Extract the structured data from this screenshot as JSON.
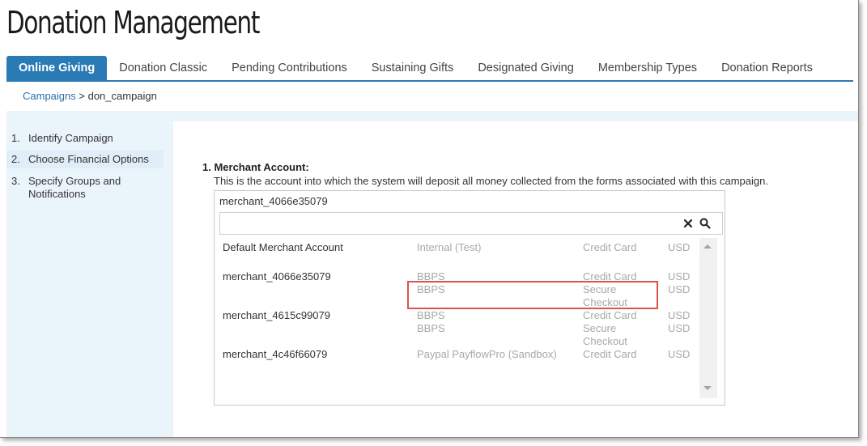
{
  "app": {
    "title": "Donation Management"
  },
  "tabs": [
    {
      "label": "Online Giving",
      "active": true
    },
    {
      "label": "Donation Classic"
    },
    {
      "label": "Pending Contributions"
    },
    {
      "label": "Sustaining Gifts"
    },
    {
      "label": "Designated Giving"
    },
    {
      "label": "Membership Types"
    },
    {
      "label": "Donation Reports"
    }
  ],
  "breadcrumb": {
    "link": "Campaigns",
    "separator": " > ",
    "current": "don_campaign"
  },
  "steps": [
    {
      "num": "1.",
      "label": "Identify Campaign"
    },
    {
      "num": "2.",
      "label": "Choose Financial Options",
      "active": true
    },
    {
      "num": "3.",
      "label": "Specify Groups and Notifications"
    }
  ],
  "merchant": {
    "label": "1. Merchant Account:",
    "description": "This is the account into which the system will deposit all money collected from the forms associated with this campaign.",
    "selected": "merchant_4066e35079",
    "search_value": "",
    "rows": [
      {
        "name": "Default Merchant Account",
        "processor": "Internal (Test)",
        "type": "Credit Card",
        "currency": "USD"
      },
      {
        "name": "merchant_4066e35079",
        "processor": "BBPS",
        "type": "Credit Card",
        "currency": "USD"
      },
      {
        "name": "",
        "processor": "BBPS",
        "type": "Secure Checkout",
        "currency": "USD"
      },
      {
        "name": "merchant_4615c99079",
        "processor": "BBPS",
        "type": "Credit Card",
        "currency": "USD"
      },
      {
        "name": "",
        "processor": "BBPS",
        "type": "Secure Checkout",
        "currency": "USD"
      },
      {
        "name": "merchant_4c46f66079",
        "processor": "Paypal PayflowPro (Sandbox)",
        "type": "Credit Card",
        "currency": "USD"
      }
    ]
  },
  "colors": {
    "accent": "#2a7ab5",
    "highlight": "#d9534f",
    "muted_text": "#a8a8a8",
    "panel_bg": "#eaf4fb"
  },
  "icons": {
    "clear": "close-icon",
    "search": "search-icon"
  }
}
